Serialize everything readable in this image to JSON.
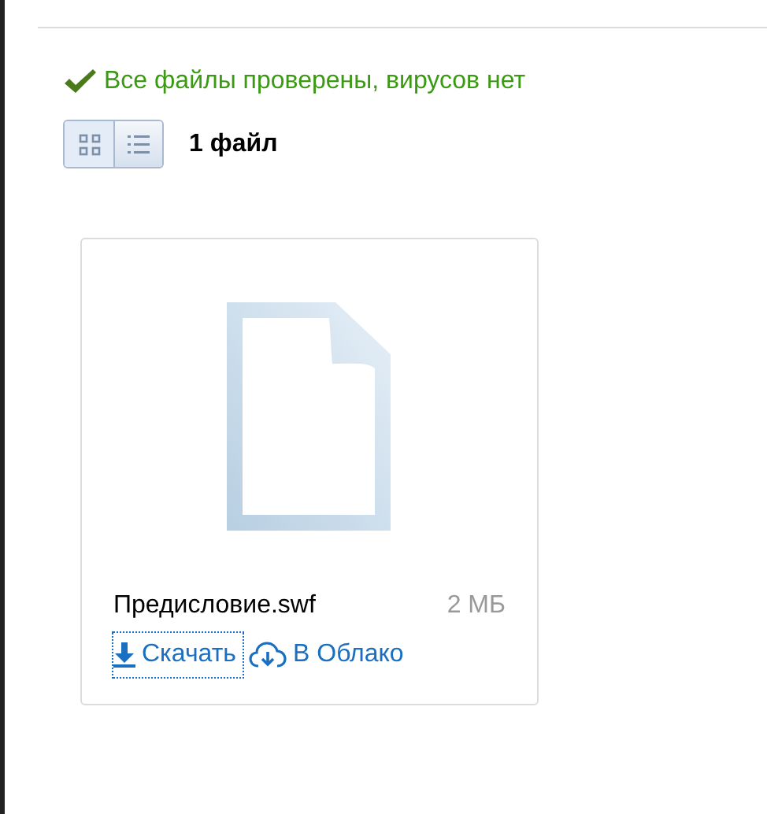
{
  "scan_status": {
    "text": "Все файлы проверены, вирусов нет"
  },
  "view_toggles": [
    {
      "kind": "grid",
      "selected": true
    },
    {
      "kind": "list",
      "selected": false
    }
  ],
  "file_count": "1 файл",
  "files": [
    {
      "name": "Предисловие.swf",
      "size": "2 МБ",
      "actions": [
        {
          "kind": "download",
          "label": "Скачать",
          "focused": true
        },
        {
          "kind": "cloud",
          "label": "В Облако",
          "focused": false
        }
      ]
    }
  ]
}
